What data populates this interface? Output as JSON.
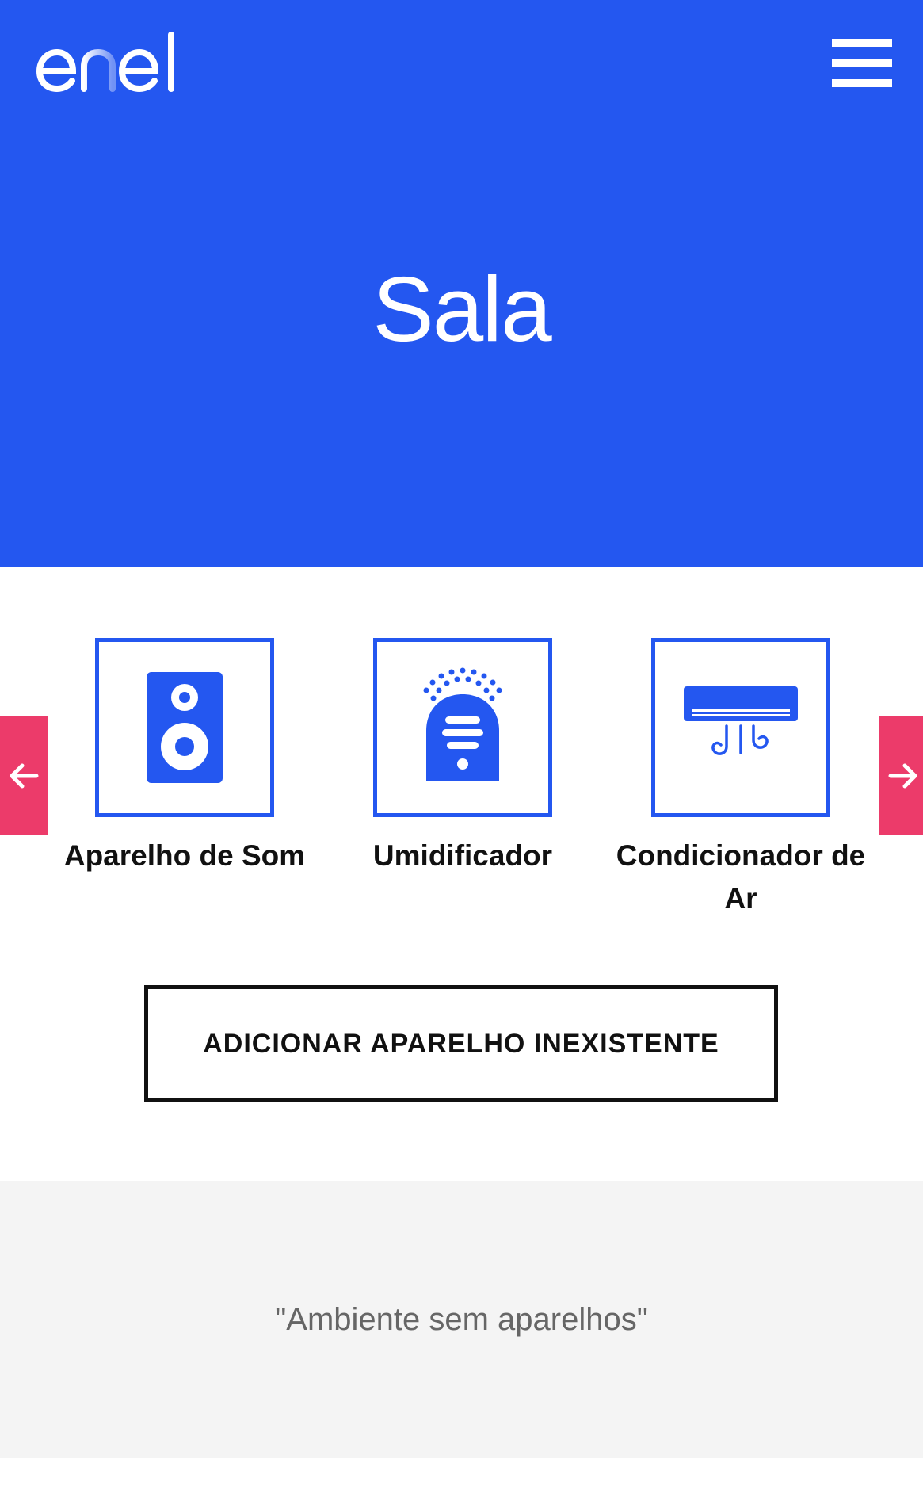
{
  "header": {
    "logo_text": "enel",
    "menu_icon": "hamburger-menu-icon",
    "title": "Sala"
  },
  "carousel": {
    "prev_icon": "arrow-left-icon",
    "next_icon": "arrow-right-icon",
    "devices": [
      {
        "label": "Aparelho de Som",
        "icon": "speaker-icon"
      },
      {
        "label": "Umidificador",
        "icon": "humidifier-icon"
      },
      {
        "label": "Condicionador de Ar",
        "icon": "air-conditioner-icon"
      }
    ]
  },
  "actions": {
    "add_label": "ADICIONAR APARELHO INEXISTENTE"
  },
  "empty_state": {
    "message": "\"Ambiente sem aparelhos\""
  },
  "colors": {
    "brand_blue": "#2457f0",
    "accent_pink": "#ec3b6a",
    "panel_gray": "#f4f4f4"
  }
}
